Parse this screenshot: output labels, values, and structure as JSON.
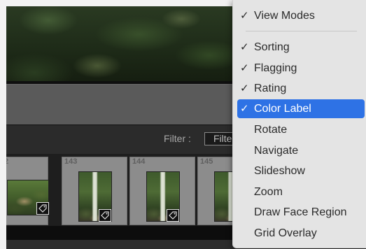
{
  "filter": {
    "label": "Filter :",
    "value": "Filte"
  },
  "filmstrip": {
    "cells": [
      {
        "number": "2"
      },
      {
        "number": "143"
      },
      {
        "number": "144"
      },
      {
        "number": "145"
      }
    ]
  },
  "menu": {
    "items": [
      {
        "label": "View Modes",
        "checked": true,
        "check": "✓"
      },
      {
        "label": "Sorting",
        "checked": true,
        "check": "✓"
      },
      {
        "label": "Flagging",
        "checked": true,
        "check": "✓"
      },
      {
        "label": "Rating",
        "checked": true,
        "check": "✓"
      },
      {
        "label": "Color Label",
        "checked": true,
        "check": "✓",
        "highlighted": true
      },
      {
        "label": "Rotate",
        "checked": false
      },
      {
        "label": "Navigate",
        "checked": false
      },
      {
        "label": "Slideshow",
        "checked": false
      },
      {
        "label": "Zoom",
        "checked": false
      },
      {
        "label": "Draw Face Region",
        "checked": false
      },
      {
        "label": "Grid Overlay",
        "checked": false
      }
    ]
  },
  "colors": {
    "menu_bg": "#e4e4e4",
    "highlight": "#2e72e5",
    "filmstrip_cell": "#8c8c8c"
  }
}
